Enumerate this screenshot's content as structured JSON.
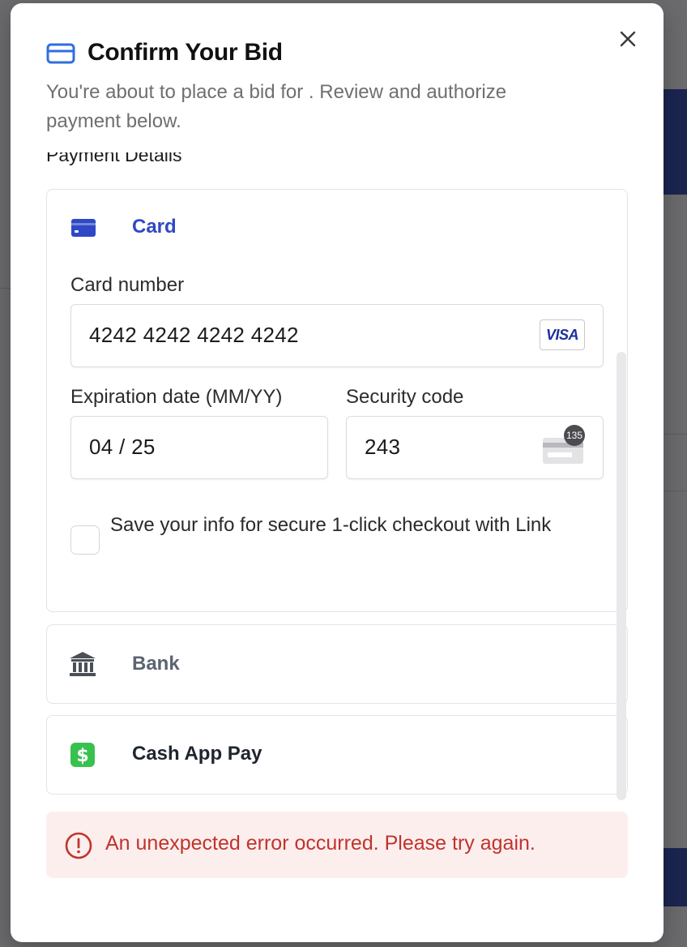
{
  "modal": {
    "title": "Confirm Your Bid",
    "subtitle": "You're about to place a bid for . Review and authorize payment below.",
    "close_icon": "close-icon",
    "header_icon": "credit-card-icon"
  },
  "payment": {
    "section_label": "Payment Details",
    "card": {
      "tab_label": "Card",
      "card_number_label": "Card number",
      "card_number_value": "4242 4242 4242 4242",
      "card_brand": "VISA",
      "expiry_label": "Expiration date (MM/YY)",
      "expiry_value": "04 / 25",
      "cvc_label": "Security code",
      "cvc_value": "243",
      "cvc_badge": "135",
      "save_info_label": "Save your info for secure 1-click checkout with Link",
      "save_info_checked": false
    },
    "other_methods": [
      {
        "label": "Bank",
        "icon": "bank-icon"
      },
      {
        "label": "Cash App Pay",
        "icon": "cash-app-icon"
      }
    ]
  },
  "error": {
    "message": "An unexpected error occurred. Please try again.",
    "icon": "error-icon"
  },
  "colors": {
    "accent": "#2f48c5",
    "cash_app_green": "#39c14f",
    "error_red": "#c0342b",
    "error_bg": "#fdeeee",
    "backdrop": "#6b6b6e"
  }
}
